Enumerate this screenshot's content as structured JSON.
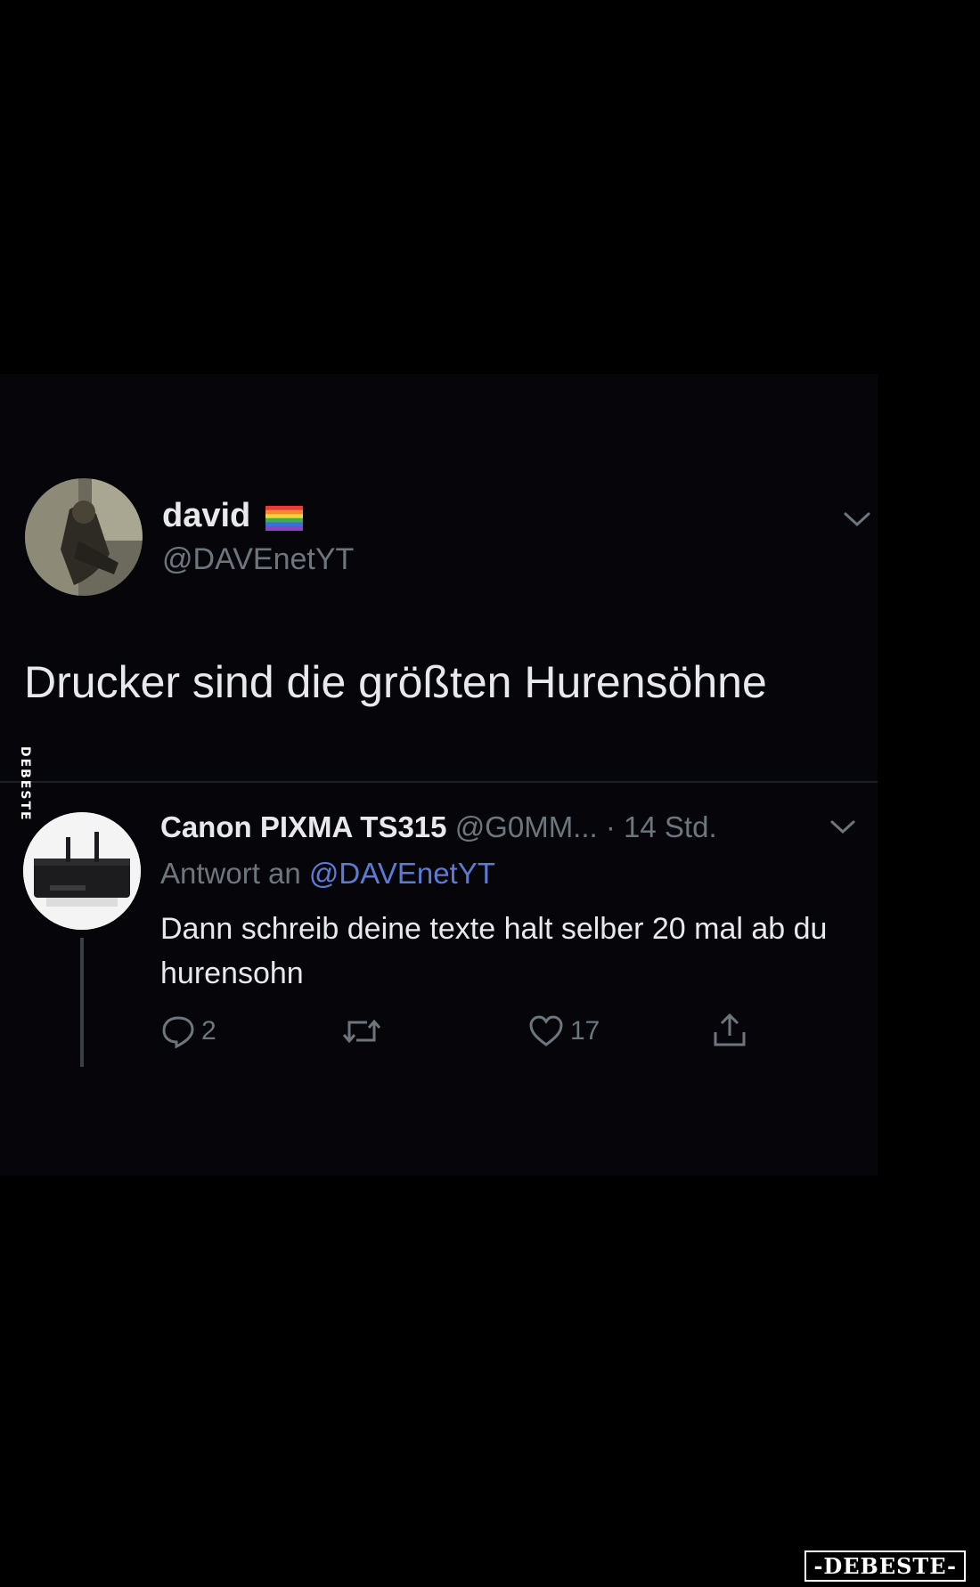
{
  "tweet": {
    "author_name": "david",
    "flag_icon": "rainbow-flag-icon",
    "handle": "@DAVEnetYT",
    "text": "Drucker sind die größten Hurensöhne"
  },
  "reply": {
    "author_name": "Canon PIXMA TS315",
    "handle": "@G0MM...",
    "time": "· 14 Std.",
    "reply_prefix": "Antwort an",
    "reply_to": "@DAVEnetYT",
    "text": "Dann schreib deine texte halt selber 20 mal ab du hurensohn",
    "actions": {
      "reply_count": "2",
      "retweet_count": "",
      "like_count": "17"
    }
  },
  "watermark": {
    "side": "DEBESTE",
    "corner": "-DEBESTE-"
  },
  "colors": {
    "background": "#000000",
    "card": "#05050a",
    "text": "#e7e9ea",
    "muted": "#6e767d",
    "mention": "#5b7bd5"
  }
}
